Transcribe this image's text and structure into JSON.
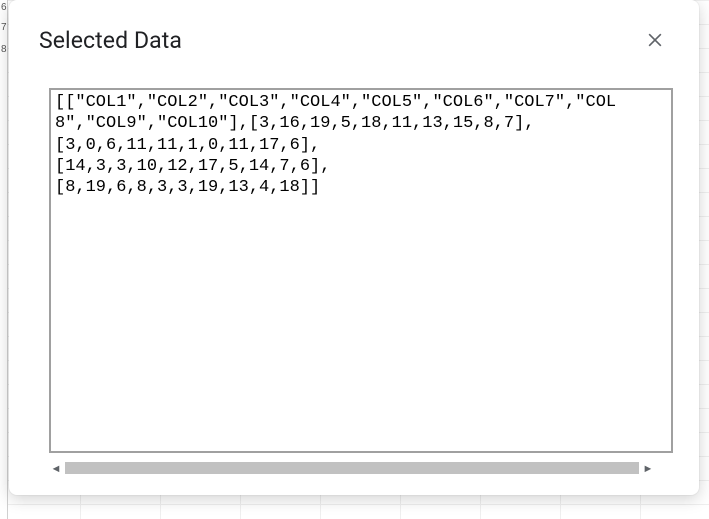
{
  "dialog": {
    "title": "Selected Data",
    "close_tooltip": "Close"
  },
  "textarea": {
    "value": "[[\"COL1\",\"COL2\",\"COL3\",\"COL4\",\"COL5\",\"COL6\",\"COL7\",\"COL8\",\"COL9\",\"COL10\"],[3,16,19,5,18,11,13,15,8,7],\n[3,0,6,11,11,1,0,11,17,6],\n[14,3,3,10,12,17,5,14,7,6],\n[8,19,6,8,3,3,19,13,4,18]]"
  },
  "bg": {
    "rownums": [
      "6",
      "7",
      "8"
    ]
  }
}
